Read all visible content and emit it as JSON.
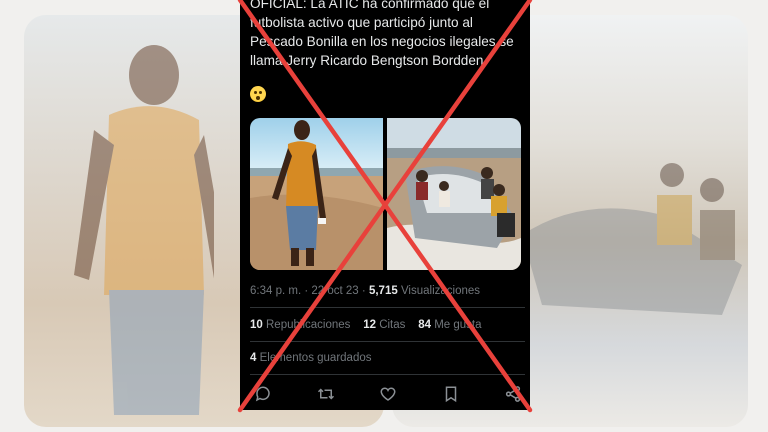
{
  "tweet": {
    "text": "OFICIAL: La ATIC ha confirmado que el futbolista activo que participó junto al Pescado Bonilla en los negocios ilegales se llama Jerry Ricardo Bengtson Bordden.",
    "emoji": "😯"
  },
  "meta": {
    "time": "6:34 p. m.",
    "separator": "·",
    "date": "22 oct 23",
    "views_count": "5,715",
    "views_label": "Visualizaciones"
  },
  "stats": {
    "reposts_count": "10",
    "reposts_label": "Republicaciones",
    "quotes_count": "12",
    "quotes_label": "Citas",
    "likes_count": "84",
    "likes_label": "Me gusta",
    "bookmarks_count": "4",
    "bookmarks_label": "Elementos guardados"
  },
  "actions": [
    "reply-icon",
    "repost-icon",
    "like-icon",
    "bookmark-icon",
    "share-icon"
  ],
  "colors": {
    "cross": "#e8413b",
    "tweet_bg": "#000000",
    "muted_text": "#71767b"
  }
}
